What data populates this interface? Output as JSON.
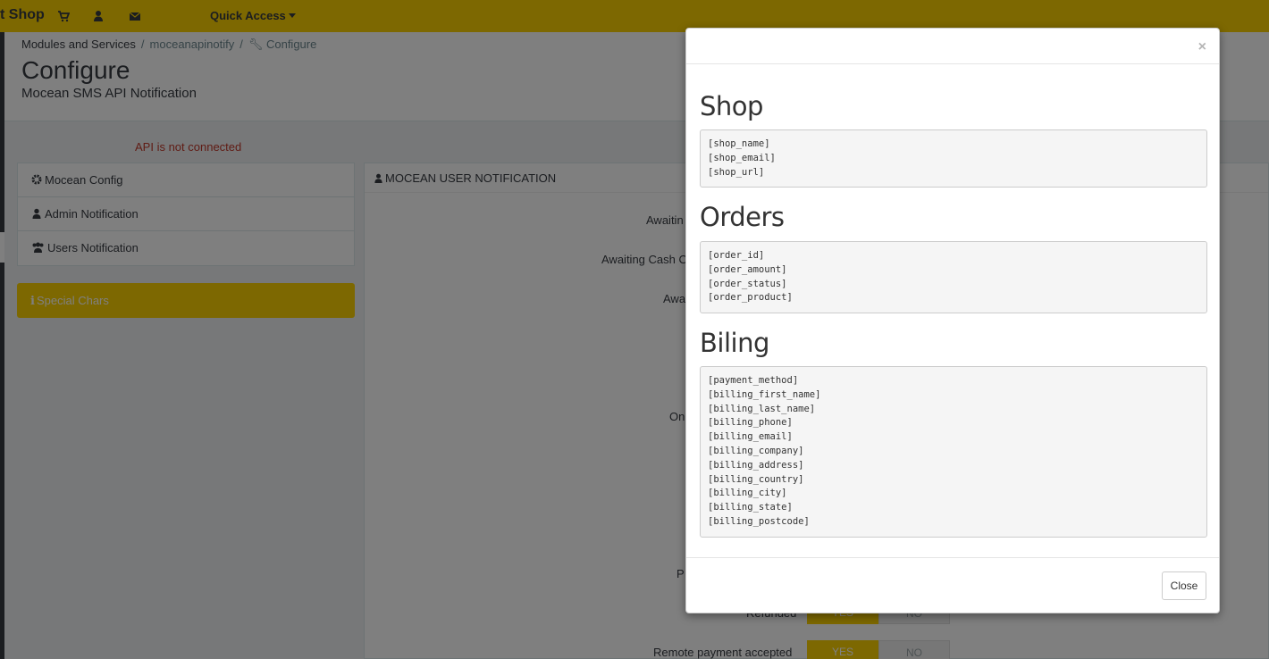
{
  "header": {
    "brand": "t Shop",
    "quick_access": "Quick Access"
  },
  "breadcrumb": {
    "item1": "Modules and Services",
    "item2": "moceanapinotify",
    "item3": "Configure"
  },
  "page": {
    "title": "Configure",
    "subtitle": "Mocean SMS API Notification",
    "api_status": "API is not connected"
  },
  "sidebar": {
    "items": [
      {
        "label": "Mocean Config",
        "icon": "gear-icon"
      },
      {
        "label": "Admin Notification",
        "icon": "user-icon"
      },
      {
        "label": "Users Notification",
        "icon": "users-icon"
      }
    ],
    "special_chars": "Special Chars"
  },
  "panel": {
    "heading": "MOCEAN USER NOTIFICATION",
    "labels": {
      "awaiting": "Awaitin",
      "awaiting_cash": "Awaiting Cash O",
      "awa": "Awa",
      "on": "On",
      "p": "P",
      "refunded": "Refunded",
      "remote_payment": "Remote payment accepted"
    },
    "toggle_yes": "YES",
    "toggle_no": "NO"
  },
  "modal": {
    "close_x": "×",
    "sections": [
      {
        "title": "Shop",
        "items": [
          "[shop_name]",
          "[shop_email]",
          "[shop_url]"
        ]
      },
      {
        "title": "Orders",
        "items": [
          "[order_id]",
          "[order_amount]",
          "[order_status]",
          "[order_product]"
        ]
      },
      {
        "title": "Biling",
        "items": [
          "[payment_method]",
          "[billing_first_name]",
          "[billing_last_name]",
          "[billing_phone]",
          "[billing_email]",
          "[billing_company]",
          "[billing_address]",
          "[billing_country]",
          "[billing_city]",
          "[billing_state]",
          "[billing_postcode]"
        ]
      }
    ],
    "close_button": "Close"
  },
  "colors": {
    "accent": "#fbd103",
    "dark": "#363a41",
    "error": "#c0392b"
  }
}
